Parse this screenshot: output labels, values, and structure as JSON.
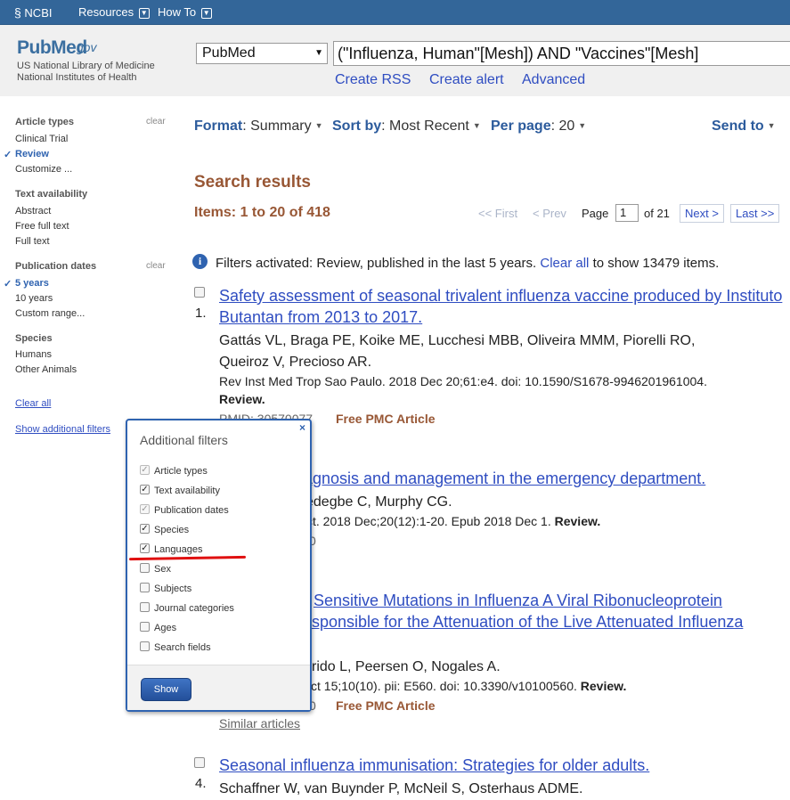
{
  "ncbi_bar": {
    "logo": "NCBI",
    "resources": "Resources",
    "how_to": "How To"
  },
  "header": {
    "logo_pub": "PubMed",
    "logo_gov": ".gov",
    "org_line1": "US National Library of Medicine",
    "org_line2": "National Institutes of Health",
    "database": "PubMed",
    "query": "(\"Influenza, Human\"[Mesh]) AND \"Vaccines\"[Mesh]",
    "links": [
      "Create RSS",
      "Create alert",
      "Advanced"
    ]
  },
  "sidebar": {
    "sections": [
      {
        "heading": "Article types",
        "clear": "clear",
        "items": [
          "Clinical Trial",
          "Review",
          "Customize ..."
        ],
        "active": "Review"
      },
      {
        "heading": "Text availability",
        "items": [
          "Abstract",
          "Free full text",
          "Full text"
        ]
      },
      {
        "heading": "Publication dates",
        "clear": "clear",
        "items": [
          "5 years",
          "10 years",
          "Custom range..."
        ],
        "active": "5 years"
      },
      {
        "heading": "Species",
        "items": [
          "Humans",
          "Other Animals"
        ]
      }
    ],
    "clear_all": "Clear all",
    "show_additional": "Show additional filters"
  },
  "toolbar": {
    "format_label": "Format",
    "format_value": "Summary",
    "sort_label": "Sort by",
    "sort_value": "Most Recent",
    "perpage_label": "Per page",
    "perpage_value": "20",
    "send_to": "Send to"
  },
  "results_header": {
    "title": "Search results",
    "items": "Items: 1 to 20 of 418",
    "first": "<< First",
    "prev": "< Prev",
    "page_label": "Page",
    "page_value": "1",
    "of_pages": "of 21",
    "next": "Next >",
    "last": "Last >>"
  },
  "filters_notice": {
    "text_before": "Filters activated: Review, published in the last 5 years.",
    "clear_all": "Clear all",
    "text_after": "to show 13479 items."
  },
  "results": [
    {
      "num": "1.",
      "title_l1": "Safety assessment of seasonal trivalent influenza vaccine produced by Instituto",
      "title_l2": "Butantan from 2013 to 2017.",
      "authors_l1": "Gattás VL, Braga PE, Koike ME, Lucchesi MBB, Oliveira MMM, Piorelli RO,",
      "authors_l2": "Queiroz V, Precioso AR.",
      "citation": "Rev Inst Med Trop Sao Paulo. 2018 Dec 20;61:e4. doi: 10.1590/S1678-9946201961004.",
      "review": "Review.",
      "pmid": "PMID: 30570077",
      "pmc": "Free PMC Article"
    },
    {
      "title_l1": "agnosis and management in the emergency department.",
      "authors_l1": "edegbe C, Murphy CG.",
      "citation": "ct. 2018 Dec;20(12):1-20. Epub 2018 Dec 1.",
      "review": "Review.",
      "pmid": "0"
    },
    {
      "title_l1": "Sensitive Mutations in Influenza A Viral Ribonucleoprotein",
      "title_l2": "sponsible for the Attenuation of the Live Attenuated Influenza",
      "authors_l1": "rido L, Peersen O, Nogales A.",
      "citation": "ct 15;10(10). pii: E560. doi: 10.3390/v10100560.",
      "review": "Review.",
      "pmid": "0",
      "pmc": "Free PMC Article",
      "similar": "Similar articles"
    },
    {
      "num": "4.",
      "title_l1": "Seasonal influenza immunisation: Strategies for older adults.",
      "authors_l1": "Schaffner W, van Buynder P, McNeil S, Osterhaus ADME."
    }
  ],
  "popup": {
    "title": "Additional filters",
    "close": "×",
    "options": [
      {
        "label": "Article types",
        "checked": true,
        "disabled": true
      },
      {
        "label": "Text availability",
        "checked": true,
        "disabled": false
      },
      {
        "label": "Publication dates",
        "checked": true,
        "disabled": true
      },
      {
        "label": "Species",
        "checked": true,
        "disabled": false
      },
      {
        "label": "Languages",
        "checked": true,
        "disabled": false
      },
      {
        "label": "Sex",
        "checked": false,
        "disabled": false
      },
      {
        "label": "Subjects",
        "checked": false,
        "disabled": false
      },
      {
        "label": "Journal categories",
        "checked": false,
        "disabled": false
      },
      {
        "label": "Ages",
        "checked": false,
        "disabled": false
      },
      {
        "label": "Search fields",
        "checked": false,
        "disabled": false
      }
    ],
    "show_button": "Show"
  },
  "colors": {
    "ncbi_bar": "#336699",
    "link": "#2f4dc1",
    "results_brown": "#985735",
    "annotation_red": "#e01010"
  }
}
